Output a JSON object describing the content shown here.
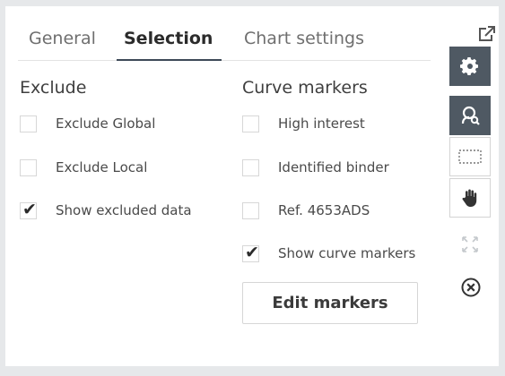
{
  "tabs": {
    "general": "General",
    "selection": "Selection",
    "chart_settings": "Chart settings",
    "active": "Selection"
  },
  "exclude": {
    "title": "Exclude",
    "items": [
      {
        "label": "Exclude Global",
        "checked": false
      },
      {
        "label": "Exclude Local",
        "checked": false
      },
      {
        "label": "Show excluded data",
        "checked": true
      }
    ]
  },
  "curve_markers": {
    "title": "Curve markers",
    "items": [
      {
        "label": "High interest",
        "checked": false
      },
      {
        "label": "Identified binder",
        "checked": false
      },
      {
        "label": "Ref. 4653ADS",
        "checked": false
      },
      {
        "label": "Show curve markers",
        "checked": true
      }
    ],
    "edit_button": "Edit markers"
  },
  "toolbar": {
    "icons": [
      "popout-icon",
      "gear-icon",
      "zoom-select-icon",
      "marquee-select-icon",
      "hand-pan-icon",
      "expand-icon",
      "close-circle-icon"
    ]
  },
  "colors": {
    "toolbar_dark": "#4f5963",
    "tab_underline": "#3d4957",
    "background": "#e6e8ea"
  },
  "check_glyph": "✔"
}
